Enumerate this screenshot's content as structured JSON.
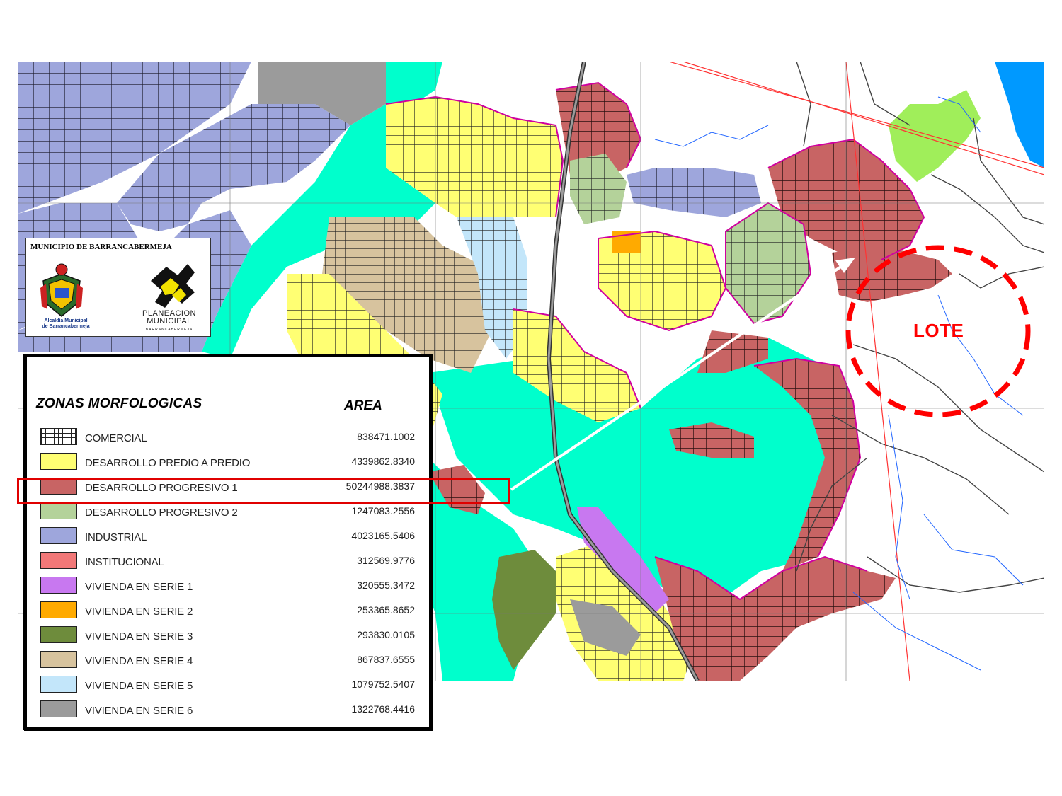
{
  "logo": {
    "municipality": "MUNICIPIO DE BARRANCABERMEJA",
    "crest_caption_1": "Alcaldía Municipal",
    "crest_caption_2": "de Barrancabermeja",
    "planning_line_1": "PLANEACION",
    "planning_line_2": "MUNICIPAL",
    "planning_sub": "BARRANCABERMEJA"
  },
  "legend": {
    "title": "ZONAS MORFOLOGICAS",
    "area_header": "AREA",
    "items": [
      {
        "label": "COMERCIAL",
        "value": "838471.1002",
        "color": "#ffffff",
        "pattern": "grid"
      },
      {
        "label": "DESARROLLO PREDIO A PREDIO",
        "value": "4339862.8340",
        "color": "#ffff73"
      },
      {
        "label": "DESARROLLO PROGRESIVO 1",
        "value": "50244988.3837",
        "color": "#c86464"
      },
      {
        "label": "DESARROLLO PROGRESIVO 2",
        "value": "1247083.2556",
        "color": "#b4d29a"
      },
      {
        "label": "INDUSTRIAL",
        "value": "4023165.5406",
        "color": "#9ea6dc"
      },
      {
        "label": "INSTITUCIONAL",
        "value": "312569.9776",
        "color": "#f27878"
      },
      {
        "label": "VIVIENDA EN SERIE 1",
        "value": "320555.3472",
        "color": "#c878f0"
      },
      {
        "label": "VIVIENDA EN SERIE 2",
        "value": "253365.8652",
        "color": "#ffaa00"
      },
      {
        "label": "VIVIENDA EN SERIE 3",
        "value": "293830.0105",
        "color": "#6e8c3c"
      },
      {
        "label": "VIVIENDA EN SERIE 4",
        "value": "867837.6555",
        "color": "#d7c39e"
      },
      {
        "label": "VIVIENDA EN SERIE 5",
        "value": "1079752.5407",
        "color": "#c3e6fa"
      },
      {
        "label": "VIVIENDA EN SERIE 6",
        "value": "1322768.4416",
        "color": "#9b9b9b"
      }
    ]
  },
  "annotation": {
    "lot_label": "LOTE",
    "highlight_color": "#e00000",
    "arrow_color": "#ffffff"
  },
  "map_colors": {
    "water": "#00ffcc",
    "industrial": "#9ea6dc",
    "residential": "#ffff73",
    "progressive_1": "#c86464",
    "progressive_2": "#b4d29a",
    "boundary": "#d000a0"
  }
}
